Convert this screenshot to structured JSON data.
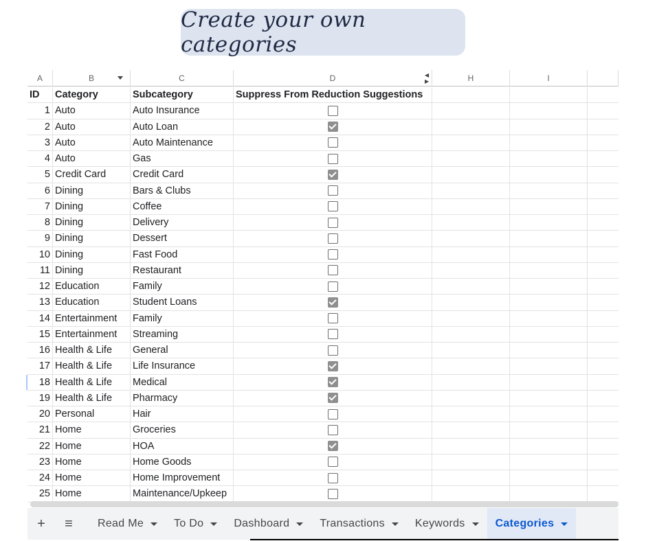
{
  "banner": {
    "text": "Create your own categories"
  },
  "columns": {
    "a": "A",
    "b": "B",
    "c": "C",
    "d": "D",
    "h": "H",
    "i": "I"
  },
  "header": {
    "id": "ID",
    "category": "Category",
    "subcategory": "Subcategory",
    "suppress": "Suppress From Reduction Suggestions"
  },
  "rows": [
    {
      "id": "1",
      "category": "Auto",
      "subcategory": "Auto Insurance",
      "checked": false
    },
    {
      "id": "2",
      "category": "Auto",
      "subcategory": "Auto Loan",
      "checked": true
    },
    {
      "id": "3",
      "category": "Auto",
      "subcategory": "Auto Maintenance",
      "checked": false
    },
    {
      "id": "4",
      "category": "Auto",
      "subcategory": "Gas",
      "checked": false
    },
    {
      "id": "5",
      "category": "Credit Card",
      "subcategory": "Credit Card",
      "checked": true
    },
    {
      "id": "6",
      "category": "Dining",
      "subcategory": "Bars & Clubs",
      "checked": false
    },
    {
      "id": "7",
      "category": "Dining",
      "subcategory": "Coffee",
      "checked": false
    },
    {
      "id": "8",
      "category": "Dining",
      "subcategory": "Delivery",
      "checked": false
    },
    {
      "id": "9",
      "category": "Dining",
      "subcategory": "Dessert",
      "checked": false
    },
    {
      "id": "10",
      "category": "Dining",
      "subcategory": "Fast Food",
      "checked": false
    },
    {
      "id": "11",
      "category": "Dining",
      "subcategory": "Restaurant",
      "checked": false
    },
    {
      "id": "12",
      "category": "Education",
      "subcategory": "Family",
      "checked": false
    },
    {
      "id": "13",
      "category": "Education",
      "subcategory": "Student Loans",
      "checked": true
    },
    {
      "id": "14",
      "category": "Entertainment",
      "subcategory": "Family",
      "checked": false
    },
    {
      "id": "15",
      "category": "Entertainment",
      "subcategory": "Streaming",
      "checked": false
    },
    {
      "id": "16",
      "category": "Health & Life",
      "subcategory": "General",
      "checked": false
    },
    {
      "id": "17",
      "category": "Health & Life",
      "subcategory": "Life Insurance",
      "checked": true
    },
    {
      "id": "18",
      "category": "Health & Life",
      "subcategory": "Medical",
      "checked": true
    },
    {
      "id": "19",
      "category": "Health & Life",
      "subcategory": "Pharmacy",
      "checked": true
    },
    {
      "id": "20",
      "category": "Personal",
      "subcategory": "Hair",
      "checked": false
    },
    {
      "id": "21",
      "category": "Home",
      "subcategory": "Groceries",
      "checked": false
    },
    {
      "id": "22",
      "category": "Home",
      "subcategory": "HOA",
      "checked": true
    },
    {
      "id": "23",
      "category": "Home",
      "subcategory": "Home Goods",
      "checked": false
    },
    {
      "id": "24",
      "category": "Home",
      "subcategory": "Home Improvement",
      "checked": false
    },
    {
      "id": "25",
      "category": "Home",
      "subcategory": "Maintenance/Upkeep",
      "checked": false
    }
  ],
  "tabs": {
    "add_icon": "plus-icon",
    "menu_icon": "hamburger-icon",
    "items": [
      {
        "label": "Read Me",
        "active": false
      },
      {
        "label": "To Do",
        "active": false
      },
      {
        "label": "Dashboard",
        "active": false
      },
      {
        "label": "Transactions",
        "active": false
      },
      {
        "label": "Keywords",
        "active": false
      },
      {
        "label": "Categories",
        "active": true
      }
    ]
  },
  "colors": {
    "banner_bg": "#dde3ef",
    "active_tab": "#0b57d0",
    "checked_box": "#8f8f8f"
  }
}
